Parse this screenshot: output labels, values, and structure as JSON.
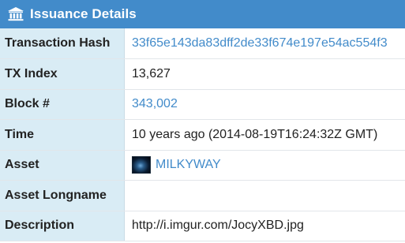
{
  "header": {
    "title": "Issuance Details",
    "icon": "bank-icon"
  },
  "colors": {
    "header_bg": "#428bca",
    "label_bg": "#d9ecf5",
    "link": "#428bca"
  },
  "rows": [
    {
      "label": "Transaction Hash",
      "value": "33f65e143da83dff2de33f674e197e54ac554f3",
      "is_link": true
    },
    {
      "label": "TX Index",
      "value": "13,627",
      "is_link": false
    },
    {
      "label": "Block #",
      "value": "343,002",
      "is_link": true
    },
    {
      "label": "Time",
      "value": "10 years ago (2014-08-19T16:24:32Z GMT)",
      "is_link": false
    },
    {
      "label": "Asset",
      "value": "MILKYWAY",
      "is_link": true,
      "thumbnail": "asset-thumbnail"
    },
    {
      "label": "Asset Longname",
      "value": "",
      "is_link": false
    },
    {
      "label": "Description",
      "value": "http://i.imgur.com/JocyXBD.jpg",
      "is_link": false
    }
  ]
}
